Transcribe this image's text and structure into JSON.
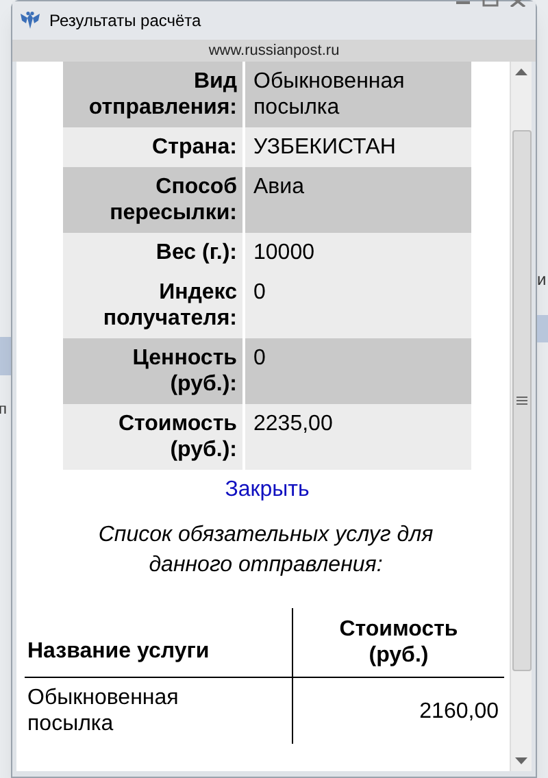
{
  "background": {
    "left_text": "п",
    "right_text": "и"
  },
  "window": {
    "title": "Результаты расчёта",
    "url": "www.russianpost.ru"
  },
  "details": [
    {
      "label": "Вид отправления:",
      "value": "Обыкновенная посылка",
      "shaded": true
    },
    {
      "label": "Страна:",
      "value": "УЗБЕКИСТАН",
      "shaded": false
    },
    {
      "label": "Способ пересылки:",
      "value": "Авиа",
      "shaded": true
    },
    {
      "label": "Вес (г.):",
      "value": "10000",
      "shaded": false
    },
    {
      "label": "Индекс получателя:",
      "value": "0",
      "shaded": false
    },
    {
      "label": "Ценность (руб.):",
      "value": "0",
      "shaded": true
    },
    {
      "label": "Стоимость (руб.):",
      "value": "2235,00",
      "shaded": false
    }
  ],
  "close_link": "Закрыть",
  "services_caption": "Список обязательных услуг для данного отправления:",
  "services": {
    "columns": [
      "Название услуги",
      "Стоимость (руб.)"
    ],
    "rows": [
      {
        "name": "Обыкновенная посылка",
        "cost": "2160,00"
      }
    ]
  }
}
